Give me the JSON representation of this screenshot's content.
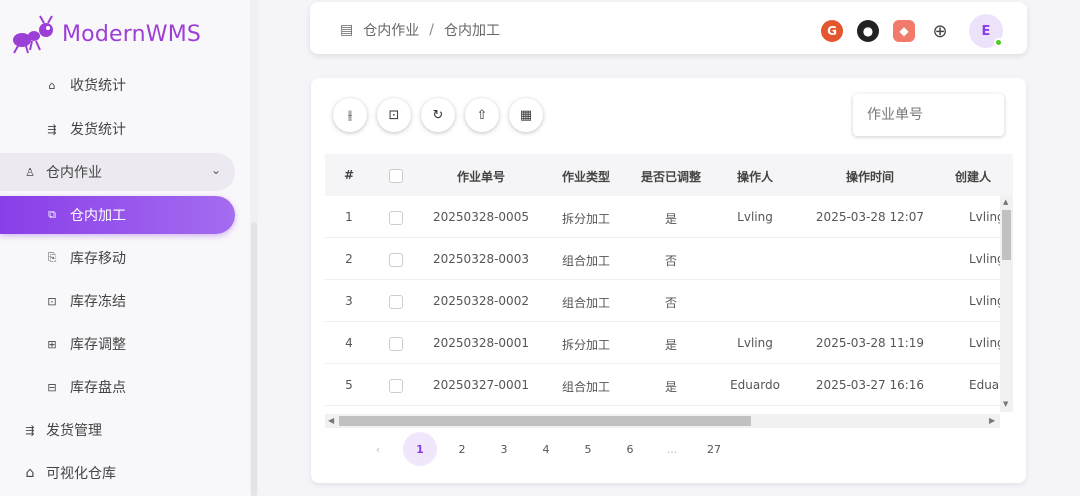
{
  "app": {
    "name": "ModernWMS"
  },
  "sidebar": {
    "items": [
      {
        "label": "收货统计",
        "icon": "warehouse-icon"
      },
      {
        "label": "发货统计",
        "icon": "truck-icon"
      },
      {
        "label": "仓内作业",
        "icon": "worker-icon"
      },
      {
        "label": "仓内加工",
        "icon": "copy-icon"
      },
      {
        "label": "库存移动",
        "icon": "move-icon"
      },
      {
        "label": "库存冻结",
        "icon": "lock-icon"
      },
      {
        "label": "库存调整",
        "icon": "adjust-icon"
      },
      {
        "label": "库存盘点",
        "icon": "count-icon"
      },
      {
        "label": "发货管理",
        "icon": "truck-icon"
      },
      {
        "label": "可视化仓库",
        "icon": "home-icon"
      }
    ]
  },
  "header": {
    "breadcrumb": [
      "仓内作业",
      "仓内加工"
    ],
    "breadcrumb_sep": "/",
    "avatar_initial": "E"
  },
  "toolbar": {
    "search_placeholder": "作业单号"
  },
  "table": {
    "columns": [
      "#",
      "",
      "作业单号",
      "作业类型",
      "是否已调整",
      "操作人",
      "操作时间",
      "创建人"
    ],
    "rows": [
      [
        "1",
        "",
        "20250328-0005",
        "拆分加工",
        "是",
        "Lvling",
        "2025-03-28 12:07",
        "Lvling"
      ],
      [
        "2",
        "",
        "20250328-0003",
        "组合加工",
        "否",
        "",
        "",
        "Lvling"
      ],
      [
        "3",
        "",
        "20250328-0002",
        "组合加工",
        "否",
        "",
        "",
        "Lvling"
      ],
      [
        "4",
        "",
        "20250328-0001",
        "拆分加工",
        "是",
        "Lvling",
        "2025-03-28 11:19",
        "Lvling"
      ],
      [
        "5",
        "",
        "20250327-0001",
        "组合加工",
        "是",
        "Eduardo",
        "2025-03-27 16:16",
        "Eduardo"
      ]
    ]
  },
  "pagination": {
    "prev": "‹",
    "pages": [
      "1",
      "2",
      "3",
      "4",
      "5",
      "6",
      "…",
      "27"
    ],
    "active": "1"
  },
  "colors": {
    "accent": "#8a3ee8",
    "logo": "#9c3fd6"
  }
}
